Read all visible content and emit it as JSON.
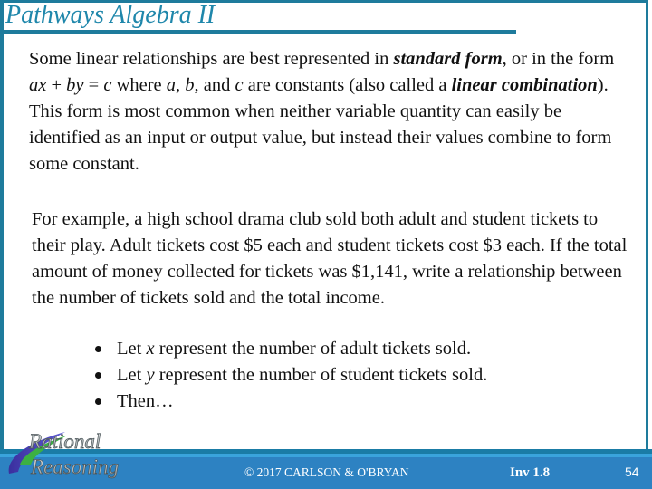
{
  "header": {
    "title": "Pathways Algebra II"
  },
  "intro": {
    "segments": [
      {
        "text": "Some linear relationships are best represented in ",
        "style": "normal"
      },
      {
        "text": "standard form",
        "style": "bold-italic"
      },
      {
        "text": ", or in the form ",
        "style": "normal"
      },
      {
        "text": "ax",
        "style": "italic"
      },
      {
        "text": " + ",
        "style": "normal"
      },
      {
        "text": "by",
        "style": "italic"
      },
      {
        "text": " = ",
        "style": "normal"
      },
      {
        "text": "c",
        "style": "italic"
      },
      {
        "text": " where ",
        "style": "normal"
      },
      {
        "text": "a",
        "style": "italic"
      },
      {
        "text": ", ",
        "style": "normal"
      },
      {
        "text": "b",
        "style": "italic"
      },
      {
        "text": ", and ",
        "style": "normal"
      },
      {
        "text": "c",
        "style": "italic"
      },
      {
        "text": " are constants (also called a ",
        "style": "normal"
      },
      {
        "text": "linear combination",
        "style": "bold-italic"
      },
      {
        "text": "). This form is most common when neither variable quantity can easily be identified as an input or output value, but instead their values combine to form some constant.",
        "style": "normal"
      }
    ]
  },
  "example": {
    "text": "For example, a high school drama club sold both adult and student tickets to their play. Adult tickets cost $5 each and student tickets cost $3 each. If the total amount of money collected for tickets was $1,141, write a relationship between the number of tickets sold and the total income.",
    "bullets": [
      {
        "prefix": "Let ",
        "var": "x",
        "suffix": " represent the number of adult tickets sold."
      },
      {
        "prefix": "Let ",
        "var": "y",
        "suffix": " represent the number of student tickets sold."
      },
      {
        "prefix": "Then…",
        "var": "",
        "suffix": ""
      }
    ]
  },
  "footer": {
    "logo_line1": "Rational",
    "logo_line2": "Reasoning",
    "copyright": "© 2017 CARLSON & O'BRYAN",
    "investigation": "Inv 1.8",
    "page_number": "54"
  },
  "colors": {
    "frame": "#1e7b9c",
    "title": "#1f87ab",
    "footer_blue": "#2d82c2"
  }
}
